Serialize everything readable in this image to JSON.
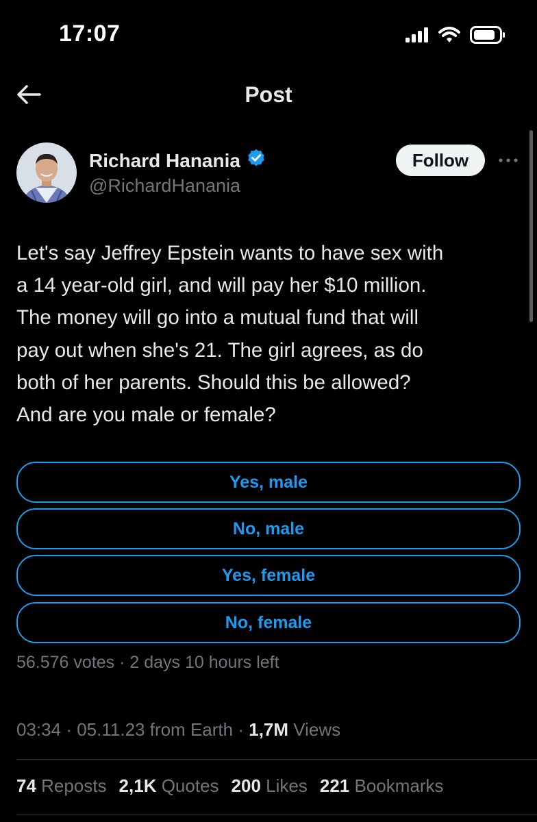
{
  "status_bar": {
    "time": "17:07"
  },
  "header": {
    "title": "Post",
    "back_icon": "arrow-left-icon"
  },
  "author": {
    "name": "Richard Hanania",
    "handle": "@RichardHanania",
    "verified_icon": "verified-badge-icon",
    "follow_label": "Follow",
    "more_icon": "more-horizontal-icon"
  },
  "tweet": {
    "text": "Let's say Jeffrey Epstein wants to have sex with\na 14 year-old girl, and will pay her $10 million.\nThe money will go into a mutual fund that will\npay out when she's 21. The girl agrees, as do\nboth of her parents. Should this be allowed?\nAnd are you male or female?"
  },
  "poll": {
    "options": [
      "Yes, male",
      "No, male",
      "Yes, female",
      "No, female"
    ],
    "meta": "56.576 votes · 2 days 10 hours left"
  },
  "meta": {
    "time": "03:34",
    "date": "05.11.23 from Earth",
    "views_count": "1,7M",
    "views_label": "Views"
  },
  "stats": [
    {
      "count": "74",
      "label": "Reposts"
    },
    {
      "count": "2,1K",
      "label": "Quotes"
    },
    {
      "count": "200",
      "label": "Likes"
    },
    {
      "count": "221",
      "label": "Bookmarks"
    }
  ],
  "colors": {
    "accent": "#1d9bf0",
    "text": "#e7e9ea",
    "secondary": "#71767b",
    "background": "#000000"
  }
}
